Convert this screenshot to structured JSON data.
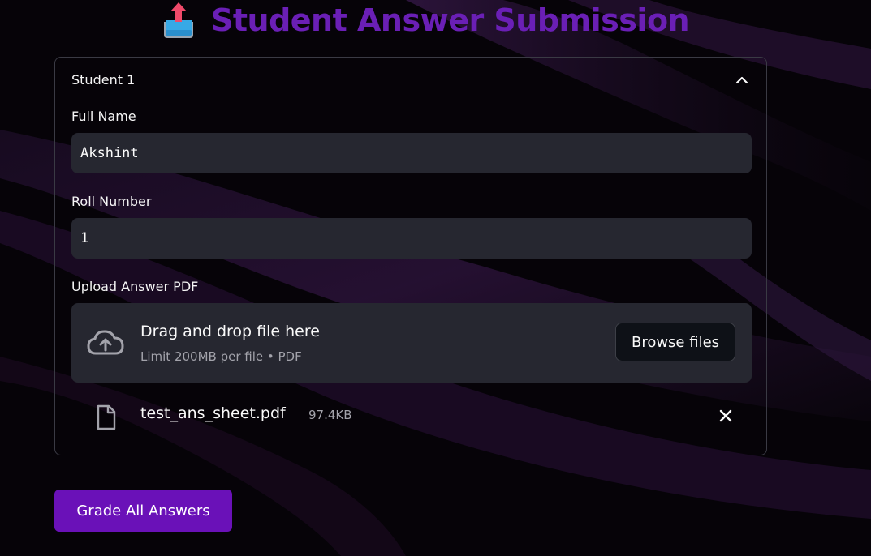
{
  "header": {
    "title": "Student Answer Submission",
    "icon": "upload-tray-icon"
  },
  "expander": {
    "label": "Student 1",
    "expanded": true
  },
  "fields": {
    "name_label": "Full Name",
    "name_value": "Akshint",
    "roll_label": "Roll Number",
    "roll_value": "1"
  },
  "uploader": {
    "label": "Upload Answer PDF",
    "drop_title": "Drag and drop file here",
    "drop_hint": "Limit 200MB per file • PDF",
    "browse_label": "Browse files",
    "file": {
      "name": "test_ans_sheet.pdf",
      "size": "97.4KB"
    }
  },
  "actions": {
    "grade_label": "Grade All Answers"
  },
  "colors": {
    "title": "#6a1fb5",
    "primary_button": "#6a11b8",
    "input_bg": "#262730",
    "background": "#050307"
  }
}
